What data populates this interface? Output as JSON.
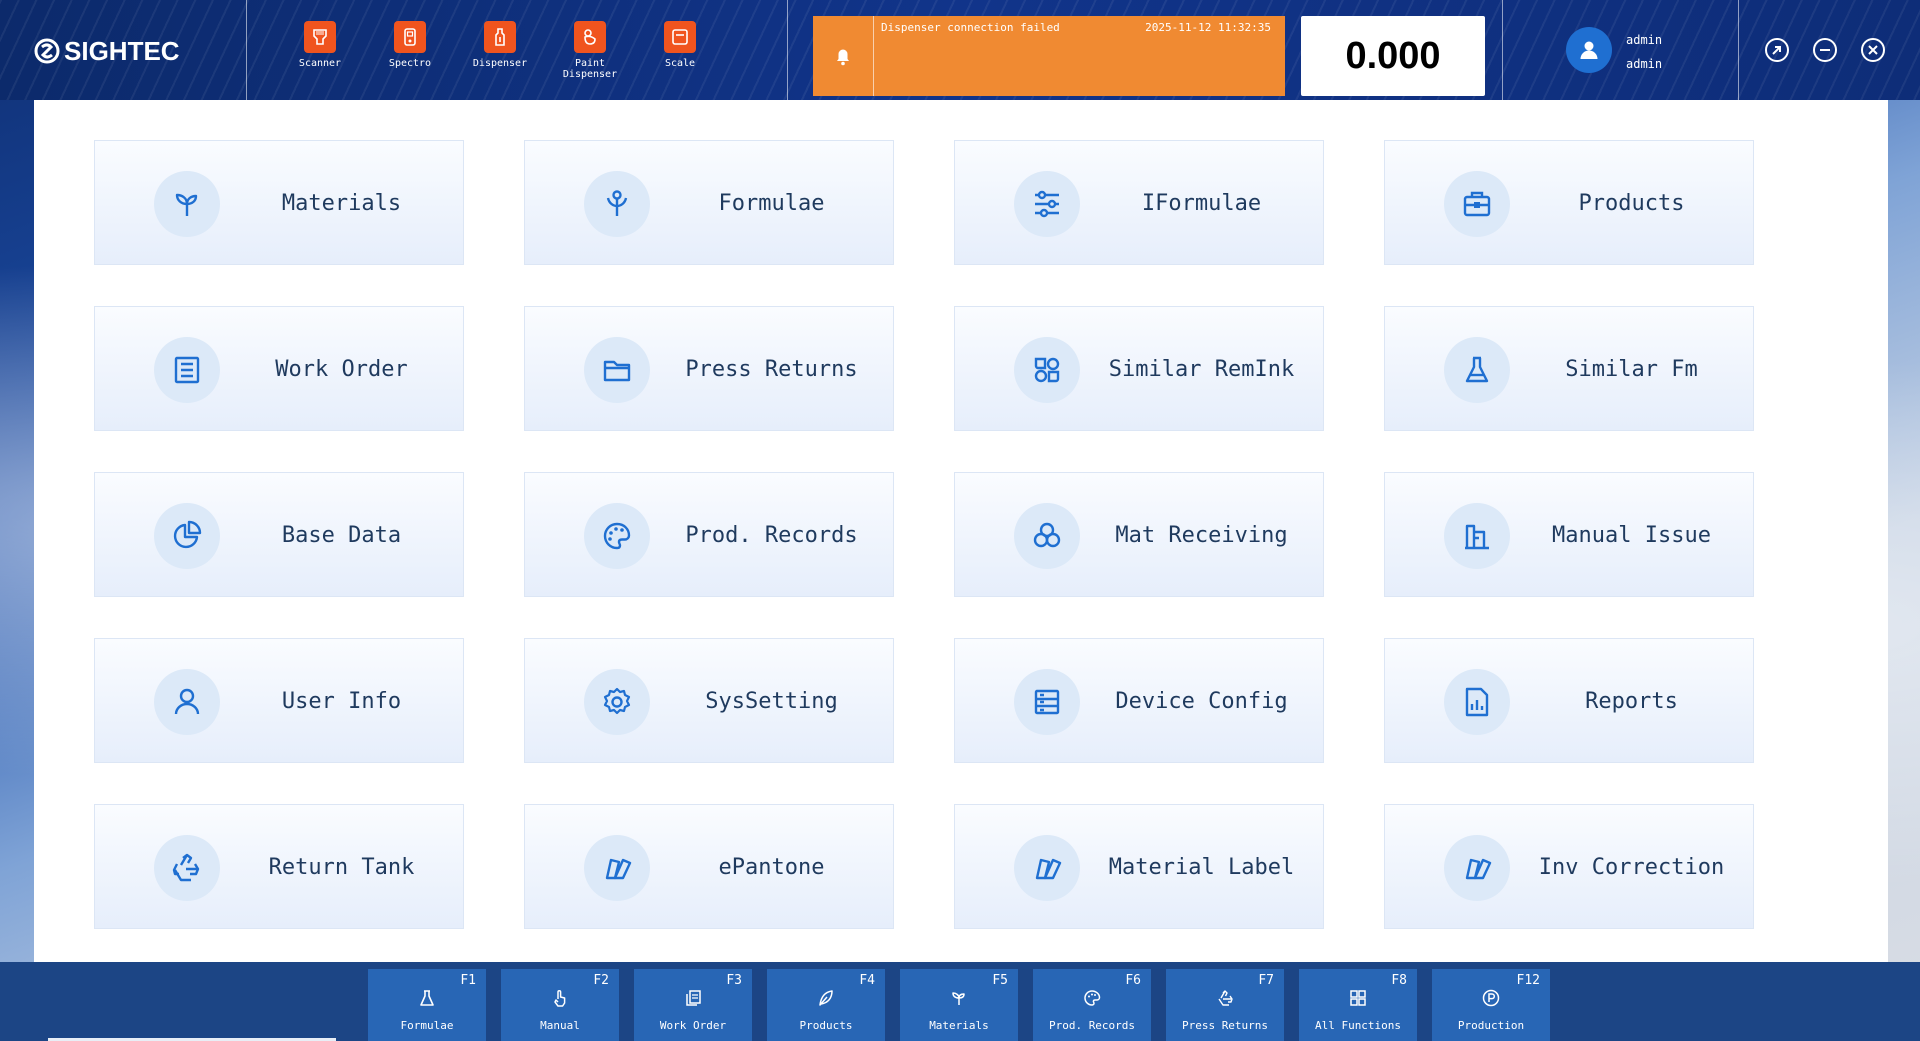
{
  "brand": {
    "logo_text": "SIGHTEC"
  },
  "devices": [
    {
      "label": "Scanner",
      "icon": "barcode-scanner-icon"
    },
    {
      "label": "Spectro",
      "icon": "spectro-icon"
    },
    {
      "label": "Dispenser",
      "icon": "dispenser-icon"
    },
    {
      "label": "Paint\nDispenser",
      "icon": "paint-dispenser-icon"
    },
    {
      "label": "Scale",
      "icon": "scale-icon"
    }
  ],
  "alert": {
    "message": "Dispenser connection failed",
    "timestamp": "2025-11-12 11:32:35",
    "color": "#f08a32"
  },
  "scale": {
    "reading": "0.000"
  },
  "user": {
    "name": "admin",
    "role": "admin"
  },
  "tiles": [
    {
      "label": "Materials",
      "icon": "sprout-icon"
    },
    {
      "label": "Formulae",
      "icon": "branch-icon"
    },
    {
      "label": "IFormulae",
      "icon": "sliders-icon"
    },
    {
      "label": "Products",
      "icon": "toolbox-icon"
    },
    {
      "label": "Work Order",
      "icon": "list-document-icon"
    },
    {
      "label": "Press Returns",
      "icon": "folder-icon"
    },
    {
      "label": "Similar RemInk",
      "icon": "shapes-icon"
    },
    {
      "label": "Similar Fm",
      "icon": "flask-icon"
    },
    {
      "label": "Base Data",
      "icon": "pie-chart-icon"
    },
    {
      "label": "Prod. Records",
      "icon": "palette-icon"
    },
    {
      "label": "Mat Receiving",
      "icon": "circles-icon"
    },
    {
      "label": "Manual Issue",
      "icon": "building-icon"
    },
    {
      "label": "User Info",
      "icon": "user-icon"
    },
    {
      "label": "SysSetting",
      "icon": "gear-icon"
    },
    {
      "label": "Device Config",
      "icon": "server-icon"
    },
    {
      "label": "Reports",
      "icon": "report-icon"
    },
    {
      "label": "Return Tank",
      "icon": "recycle-icon"
    },
    {
      "label": "ePantone",
      "icon": "swatch-icon"
    },
    {
      "label": "Material Label",
      "icon": "swatch-icon"
    },
    {
      "label": "Inv Correction",
      "icon": "swatch-icon"
    }
  ],
  "fkeys": [
    {
      "key": "F1",
      "label": "Formulae",
      "icon": "flask-icon"
    },
    {
      "key": "F2",
      "label": "Manual",
      "icon": "hand-icon"
    },
    {
      "key": "F3",
      "label": "Work Order",
      "icon": "copy-icon"
    },
    {
      "key": "F4",
      "label": "Products",
      "icon": "leaf-icon"
    },
    {
      "key": "F5",
      "label": "Materials",
      "icon": "sprout-icon"
    },
    {
      "key": "F6",
      "label": "Prod. Records",
      "icon": "palette-icon"
    },
    {
      "key": "F7",
      "label": "Press Returns",
      "icon": "recycle-icon"
    },
    {
      "key": "F8",
      "label": "All Functions",
      "icon": "grid-icon"
    },
    {
      "key": "F12",
      "label": "Production",
      "icon": "p-circle-icon"
    }
  ],
  "colors": {
    "accent": "#1f6fd1",
    "header": "#11348a",
    "device_icon": "#f0541e",
    "footer": "#1c4585",
    "fkey": "#2866b5"
  }
}
